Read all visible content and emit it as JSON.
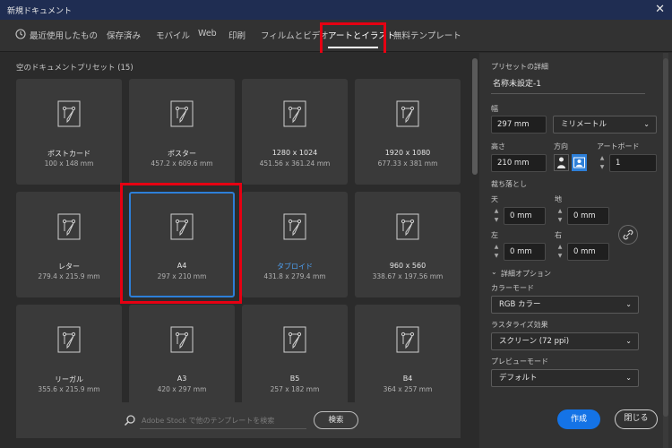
{
  "window": {
    "title": "新規ドキュメント",
    "close_glyph": "✕"
  },
  "tabs": [
    {
      "label": "最近使用したもの",
      "icon": "clock-icon"
    },
    {
      "label": "保存済み"
    },
    {
      "label": "モバイル"
    },
    {
      "label": "Web"
    },
    {
      "label": "印刷"
    },
    {
      "label": "フィルムとビデオ"
    },
    {
      "label": "アートとイラスト",
      "active": true
    },
    {
      "label": "無料テンプレート"
    }
  ],
  "presets": {
    "title": "空のドキュメントプリセット (15)",
    "items": [
      {
        "name": "ポストカード",
        "size": "100 x 148 mm"
      },
      {
        "name": "ポスター",
        "size": "457.2 x 609.6 mm"
      },
      {
        "name": "1280 x 1024",
        "size": "451.56 x 361.24 mm"
      },
      {
        "name": "1920 x 1080",
        "size": "677.33 x 381 mm"
      },
      {
        "name": "レター",
        "size": "279.4 x 215.9 mm"
      },
      {
        "name": "A4",
        "size": "297 x 210 mm",
        "selected": true
      },
      {
        "name": "タブロイド",
        "size": "431.8 x 279.4 mm",
        "highlight": true
      },
      {
        "name": "960 x 560",
        "size": "338.67 x 197.56 mm"
      },
      {
        "name": "リーガル",
        "size": "355.6 x 215.9 mm"
      },
      {
        "name": "A3",
        "size": "420 x 297 mm"
      },
      {
        "name": "B5",
        "size": "257 x 182 mm"
      },
      {
        "name": "B4",
        "size": "364 x 257 mm"
      }
    ]
  },
  "search": {
    "placeholder": "Adobe Stock で他のテンプレートを検索",
    "button_label": "検索"
  },
  "details": {
    "section_title": "プリセットの詳細",
    "doc_name": "名称未設定-1",
    "width_label": "幅",
    "width_value": "297 mm",
    "unit_value": "ミリメートル",
    "height_label": "高さ",
    "height_value": "210 mm",
    "orientation_label": "方向",
    "artboard_label": "アートボード",
    "artboard_value": "1",
    "bleed_label": "裁ち落とし",
    "bleed_top_label": "天",
    "bleed_top_value": "0 mm",
    "bleed_bottom_label": "地",
    "bleed_bottom_value": "0 mm",
    "bleed_left_label": "左",
    "bleed_left_value": "0 mm",
    "bleed_right_label": "右",
    "bleed_right_value": "0 mm",
    "advanced_label": "詳細オプション",
    "color_mode_label": "カラーモード",
    "color_mode_value": "RGB カラー",
    "raster_label": "ラスタライズ効果",
    "raster_value": "スクリーン (72 ppi)",
    "preview_label": "プレビューモード",
    "preview_value": "デフォルト"
  },
  "actions": {
    "create_label": "作成",
    "close_label": "閉じる"
  },
  "colors": {
    "accent": "#1473e6",
    "highlight_box": "#e60012",
    "selected_border": "#2d7fd8"
  }
}
